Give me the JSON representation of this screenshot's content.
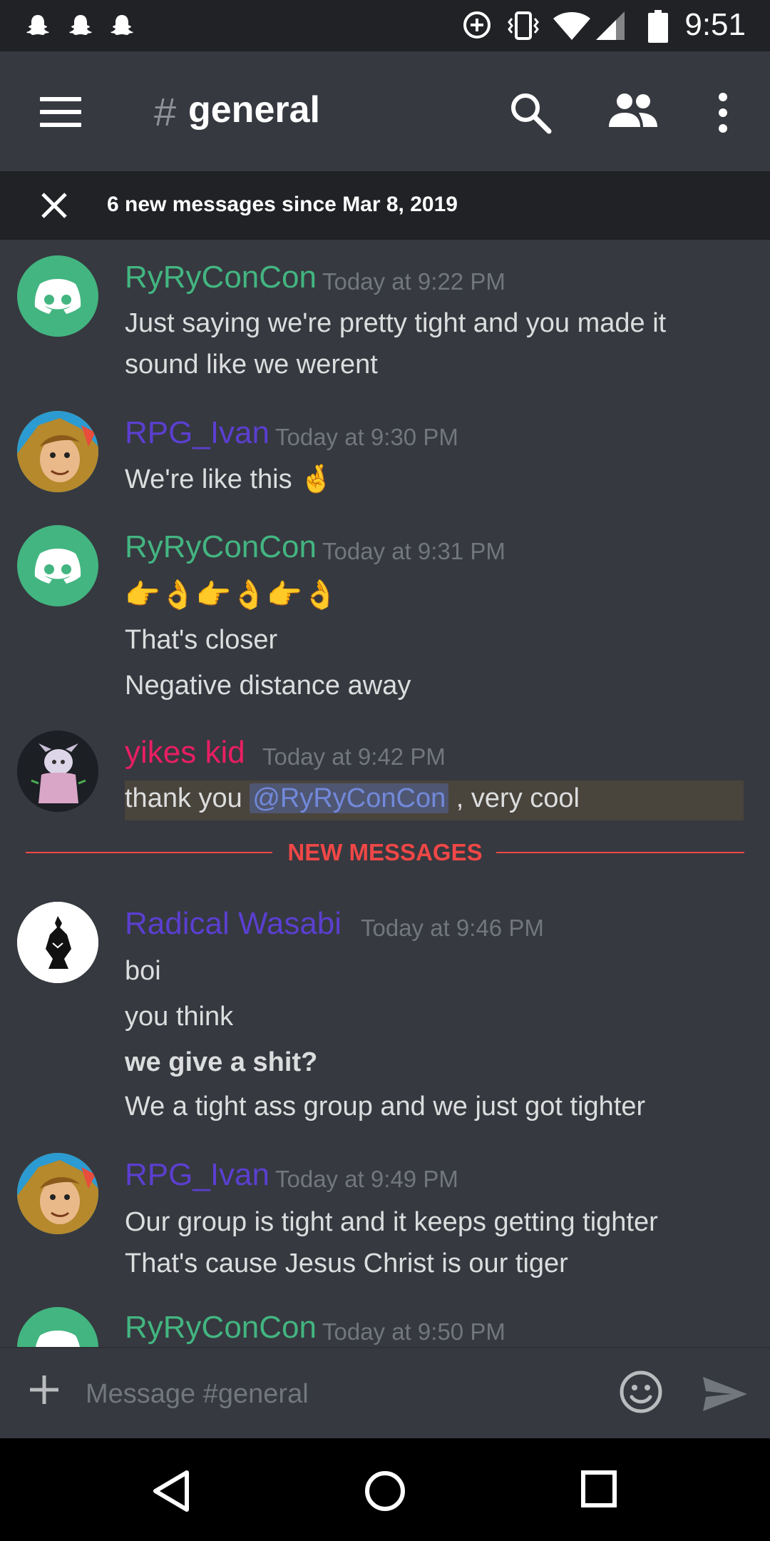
{
  "status_bar": {
    "time": "9:51",
    "notification_icons": [
      "ghost-icon",
      "ghost-icon",
      "ghost-icon"
    ],
    "system_icons": [
      "data-saver-icon",
      "vibrate-icon",
      "wifi-icon",
      "signal-icon",
      "battery-icon"
    ]
  },
  "app_bar": {
    "channel_hash": "#",
    "channel_name": "general",
    "icons": [
      "menu-icon",
      "search-icon",
      "members-icon",
      "more-vertical-icon"
    ]
  },
  "new_messages_bar": {
    "text": "6 new messages since Mar 8, 2019"
  },
  "colors": {
    "ryry": "#43b581",
    "ivan": "#5b3fd0",
    "yikes": "#e91e63",
    "wasabi": "#5b3fd0",
    "new_divider": "#f04747",
    "mention": "#7289da"
  },
  "messages": [
    {
      "author": "RyRyConCon",
      "timestamp": "Today at 9:22 PM",
      "avatar": "discord-logo-avatar",
      "lines": [
        "Just saying we're pretty tight and you made it",
        "sound like we werent"
      ]
    },
    {
      "author": "RPG_Ivan",
      "timestamp": "Today at 9:30 PM",
      "avatar": "cartoon-face-avatar",
      "lines": [
        "We're like this 🤞"
      ]
    },
    {
      "author": "RyRyConCon",
      "timestamp": "Today at 9:31 PM",
      "avatar": "discord-logo-avatar",
      "lines": [
        "👉👌👉👌👉👌",
        "That's closer",
        "Negative distance away"
      ]
    },
    {
      "author": "yikes kid",
      "timestamp": "Today at 9:42 PM",
      "avatar": "character-avatar",
      "mention_line": {
        "before": "thank you ",
        "mention": "@RyRyConCon",
        "after": " , very cool"
      }
    },
    {
      "author": "Radical Wasabi",
      "timestamp": "Today at 9:46 PM",
      "avatar": "silhouette-avatar",
      "lines": [
        "boi",
        "you think",
        "we give a shit?",
        "We a tight ass group and we just got tighter"
      ]
    },
    {
      "author": "RPG_Ivan",
      "timestamp": "Today at 9:49 PM",
      "avatar": "cartoon-face-avatar",
      "lines": [
        "Our group is tight and it keeps getting tighter",
        "That's cause Jesus Christ is our tiger"
      ]
    },
    {
      "author": "RyRyConCon",
      "timestamp": "Today at 9:50 PM",
      "avatar": "discord-logo-avatar",
      "lines": []
    }
  ],
  "new_messages_divider": "NEW MESSAGES",
  "composer": {
    "placeholder": "Message #general",
    "value": ""
  },
  "nav_bar": [
    "back-icon",
    "home-icon",
    "recents-icon"
  ]
}
